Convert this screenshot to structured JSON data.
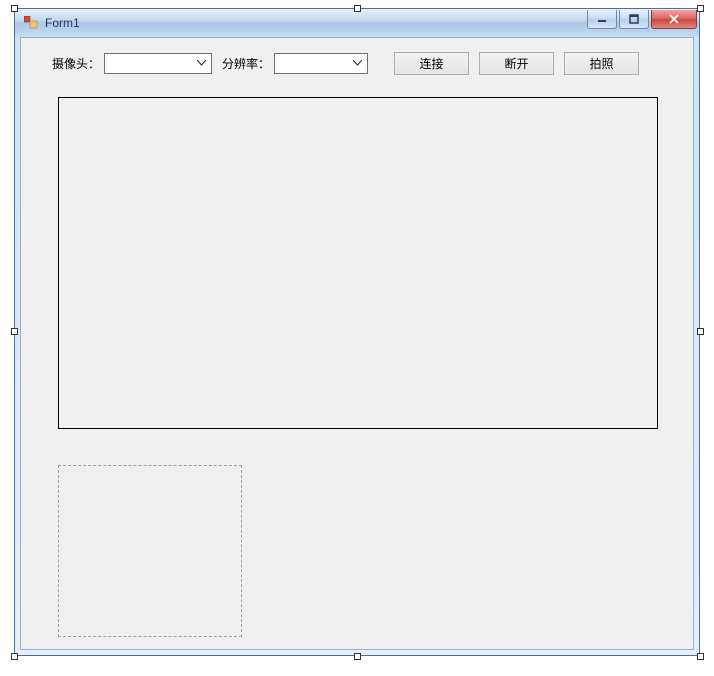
{
  "window": {
    "title": "Form1"
  },
  "toolbar": {
    "camera_label": "摄像头：",
    "camera_value": "",
    "resolution_label": "分辨率：",
    "resolution_value": "",
    "connect_label": "连接",
    "disconnect_label": "断开",
    "snapshot_label": "拍照"
  }
}
